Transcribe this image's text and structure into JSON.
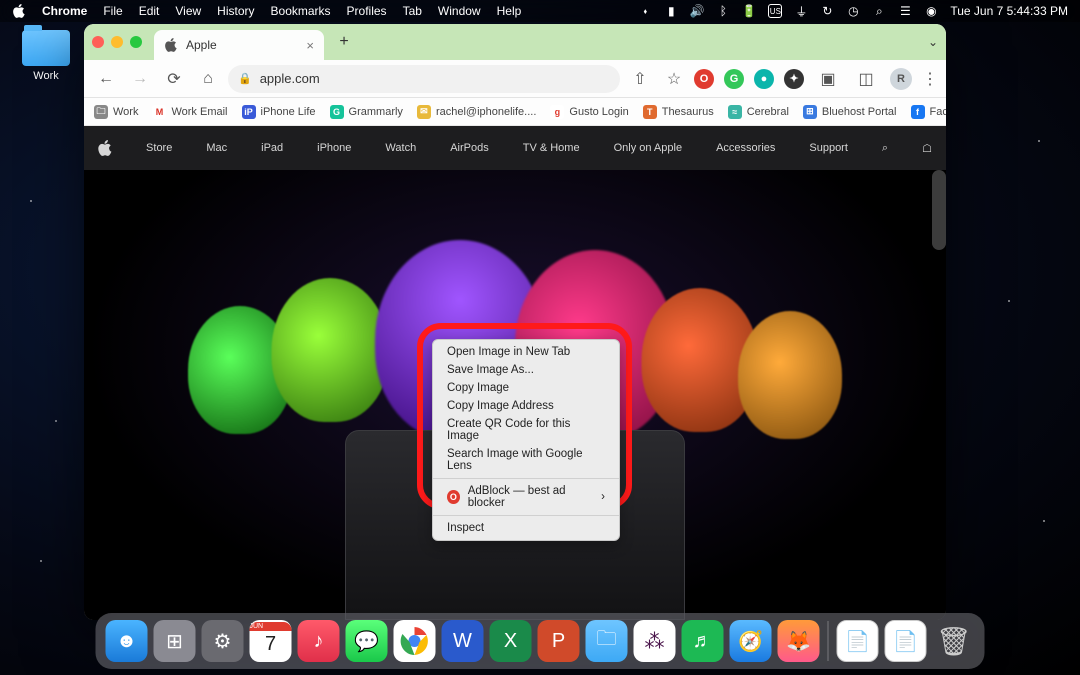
{
  "menubar": {
    "app": "Chrome",
    "items": [
      "File",
      "Edit",
      "View",
      "History",
      "Bookmarks",
      "Profiles",
      "Tab",
      "Window",
      "Help"
    ],
    "clock": "Tue Jun 7  5:44:33 PM"
  },
  "desktop": {
    "folder_label": "Work"
  },
  "chrome": {
    "tab_title": "Apple",
    "url": "apple.com",
    "profile_initial": "R"
  },
  "bookmarks": [
    {
      "label": "Work",
      "color": "#888"
    },
    {
      "label": "Work Email",
      "color": "#d93025"
    },
    {
      "label": "iPhone Life",
      "color": "#3a5ad8"
    },
    {
      "label": "Grammarly",
      "color": "#15c39a"
    },
    {
      "label": "rachel@iphonelife....",
      "color": "#e8b93a"
    },
    {
      "label": "Gusto Login",
      "color": "#e03b2f"
    },
    {
      "label": "Thesaurus",
      "color": "#e06a2f"
    },
    {
      "label": "Cerebral",
      "color": "#3ab5a5"
    },
    {
      "label": "Bluehost Portal",
      "color": "#3a7ae0"
    },
    {
      "label": "Facebook",
      "color": "#1877f2"
    }
  ],
  "apple_nav": [
    "Store",
    "Mac",
    "iPad",
    "iPhone",
    "Watch",
    "AirPods",
    "TV & Home",
    "Only on Apple",
    "Accessories",
    "Support"
  ],
  "context_menu": {
    "items_a": [
      "Open Image in New Tab",
      "Save Image As...",
      "Copy Image",
      "Copy Image Address",
      "Create QR Code for this Image",
      "Search Image with Google Lens"
    ],
    "adblock": "AdBlock — best ad blocker",
    "inspect": "Inspect"
  },
  "dock": {
    "cal_month": "JUN",
    "cal_day": "7"
  }
}
